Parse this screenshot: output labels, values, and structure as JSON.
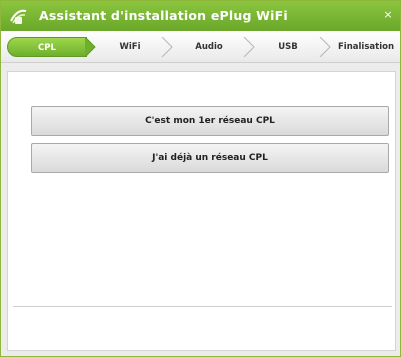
{
  "window": {
    "title": "Assistant d'installation ePlug WiFi",
    "close_glyph": "×",
    "accent_color": "#7ab834"
  },
  "steps": [
    {
      "label": "CPL",
      "active": true
    },
    {
      "label": "WiFi",
      "active": false
    },
    {
      "label": "Audio",
      "active": false
    },
    {
      "label": "USB",
      "active": false
    },
    {
      "label": "Finalisation",
      "active": false
    }
  ],
  "main": {
    "first_network_label": "C'est mon 1er réseau CPL",
    "existing_network_label": "J'ai déjà un réseau CPL"
  },
  "icons": {
    "logo": "eplug-wifi-logo-icon",
    "close": "close-icon",
    "step_separator": "chevron-right-icon"
  }
}
